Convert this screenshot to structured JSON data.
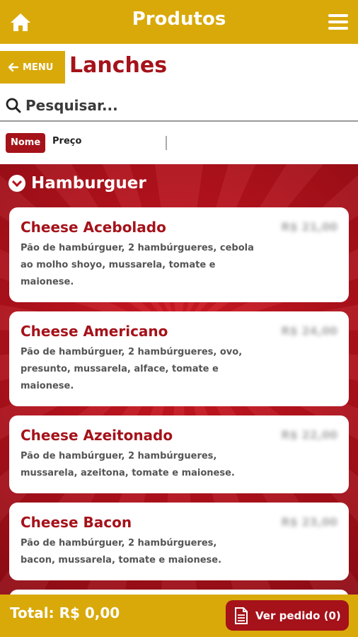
{
  "header": {
    "title": "Produtos",
    "home_icon": "home-icon",
    "menu_icon": "hamburger-menu-icon",
    "brand_color": "#d9a90a"
  },
  "nav": {
    "back_label": "MENU",
    "section_title": "Lanches"
  },
  "search": {
    "placeholder": "Pesquisar...",
    "value": ""
  },
  "sort": {
    "options": [
      "Nome",
      "Preço"
    ],
    "selected": "Nome"
  },
  "category": {
    "name": "Hamburguer",
    "products": [
      {
        "name": "Cheese Acebolado",
        "description": "Pão de hambúrguer, 2 hambúrgueres, cebola ao molho shoyo, mussarela, tomate e maionese.",
        "price": "R$ 21,00"
      },
      {
        "name": "Cheese Americano",
        "description": "Pão de hambúrguer, 2 hambúrgueres, ovo, presunto, mussarela, alface, tomate e maionese.",
        "price": "R$ 24,00"
      },
      {
        "name": "Cheese Azeitonado",
        "description": "Pão de hambúrguer, 2 hambúrgueres, mussarela, azeitona, tomate e maionese.",
        "price": "R$ 22,00"
      },
      {
        "name": "Cheese Bacon",
        "description": "Pão de hambúrguer, 2 hambúrgueres, bacon, mussarela, tomate e maionese.",
        "price": "R$ 23,00"
      }
    ]
  },
  "footer": {
    "total_label": "Total: R$ 0,00",
    "order_button_label": "Ver pedido (0)",
    "accent_color": "#a5121a"
  }
}
